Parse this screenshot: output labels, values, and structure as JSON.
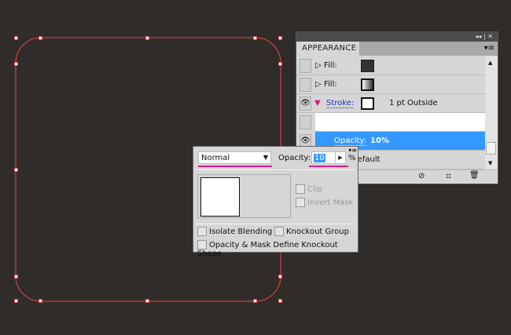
{
  "appearance": {
    "title": "APPEARANCE",
    "collapse_glyph": "◂◂ | ✕",
    "menu_glyph": "▾≡",
    "rows": [
      {
        "label": "Fill:"
      },
      {
        "label": "Fill:"
      },
      {
        "label": "Stroke:",
        "value": "1 pt  Outside"
      },
      {
        "label": "Opacity:",
        "value": "10%"
      },
      {
        "label": "Default"
      }
    ]
  },
  "transparency": {
    "blend_mode": "Normal",
    "opacity_label": "Opacity:",
    "opacity_value": "10",
    "percent": "%",
    "clip": "Clip",
    "invert_mask": "Invert Mask",
    "isolate": "Isolate Blending",
    "knockout": "Knockout Group",
    "define": "Opacity & Mask Define Knockout Shape"
  },
  "colors": {
    "canvas": "#302c2a",
    "path": "#e8474f",
    "selection": "#3399ff",
    "underline": "#e0198a"
  }
}
